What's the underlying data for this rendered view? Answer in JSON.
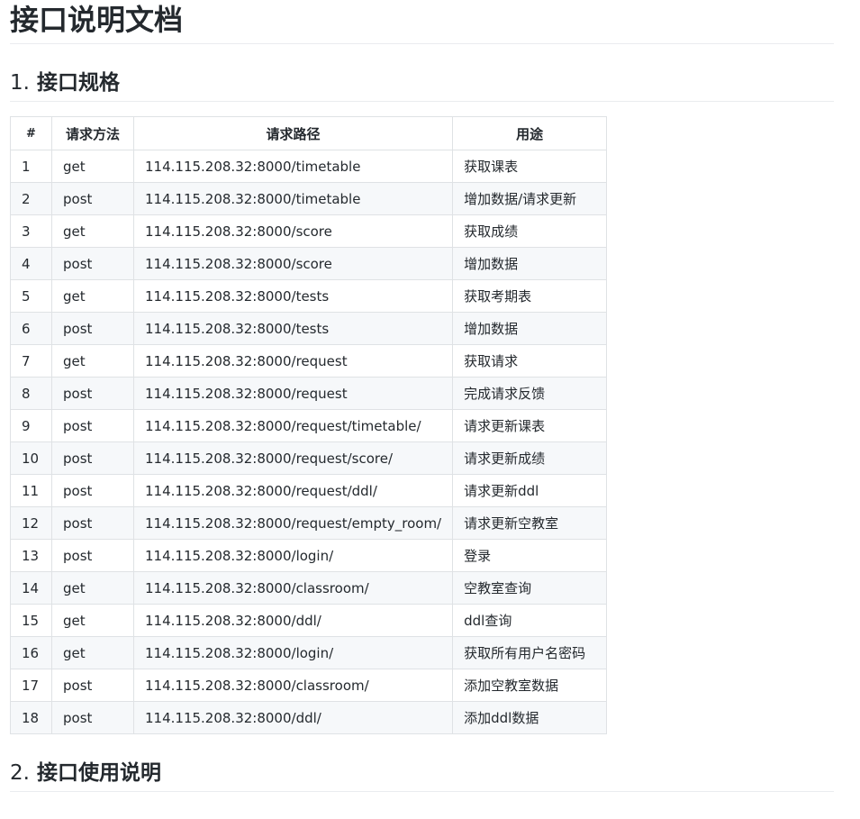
{
  "title": "接口说明文档",
  "section1": {
    "number": "1.",
    "title": "接口规格"
  },
  "section2": {
    "number": "2.",
    "title": "接口使用说明"
  },
  "table": {
    "headers": {
      "idx": "#",
      "method": "请求方法",
      "path": "请求路径",
      "use": "用途"
    },
    "rows": [
      {
        "idx": "1",
        "method": "get",
        "path": "114.115.208.32:8000/timetable",
        "use": "获取课表"
      },
      {
        "idx": "2",
        "method": "post",
        "path": "114.115.208.32:8000/timetable",
        "use": "增加数据/请求更新"
      },
      {
        "idx": "3",
        "method": "get",
        "path": "114.115.208.32:8000/score",
        "use": "获取成绩"
      },
      {
        "idx": "4",
        "method": "post",
        "path": "114.115.208.32:8000/score",
        "use": "增加数据"
      },
      {
        "idx": "5",
        "method": "get",
        "path": "114.115.208.32:8000/tests",
        "use": "获取考期表"
      },
      {
        "idx": "6",
        "method": "post",
        "path": "114.115.208.32:8000/tests",
        "use": "增加数据"
      },
      {
        "idx": "7",
        "method": "get",
        "path": "114.115.208.32:8000/request",
        "use": "获取请求"
      },
      {
        "idx": "8",
        "method": "post",
        "path": "114.115.208.32:8000/request",
        "use": "完成请求反馈"
      },
      {
        "idx": "9",
        "method": "post",
        "path": "114.115.208.32:8000/request/timetable/",
        "use": "请求更新课表"
      },
      {
        "idx": "10",
        "method": "post",
        "path": "114.115.208.32:8000/request/score/",
        "use": "请求更新成绩"
      },
      {
        "idx": "11",
        "method": "post",
        "path": "114.115.208.32:8000/request/ddl/",
        "use": "请求更新ddl"
      },
      {
        "idx": "12",
        "method": "post",
        "path": "114.115.208.32:8000/request/empty_room/",
        "use": "请求更新空教室"
      },
      {
        "idx": "13",
        "method": "post",
        "path": "114.115.208.32:8000/login/",
        "use": "登录"
      },
      {
        "idx": "14",
        "method": "get",
        "path": "114.115.208.32:8000/classroom/",
        "use": "空教室查询"
      },
      {
        "idx": "15",
        "method": "get",
        "path": "114.115.208.32:8000/ddl/",
        "use": "ddl查询"
      },
      {
        "idx": "16",
        "method": "get",
        "path": "114.115.208.32:8000/login/",
        "use": "获取所有用户名密码"
      },
      {
        "idx": "17",
        "method": "post",
        "path": "114.115.208.32:8000/classroom/",
        "use": "添加空教室数据"
      },
      {
        "idx": "18",
        "method": "post",
        "path": "114.115.208.32:8000/ddl/",
        "use": "添加ddl数据"
      }
    ]
  }
}
